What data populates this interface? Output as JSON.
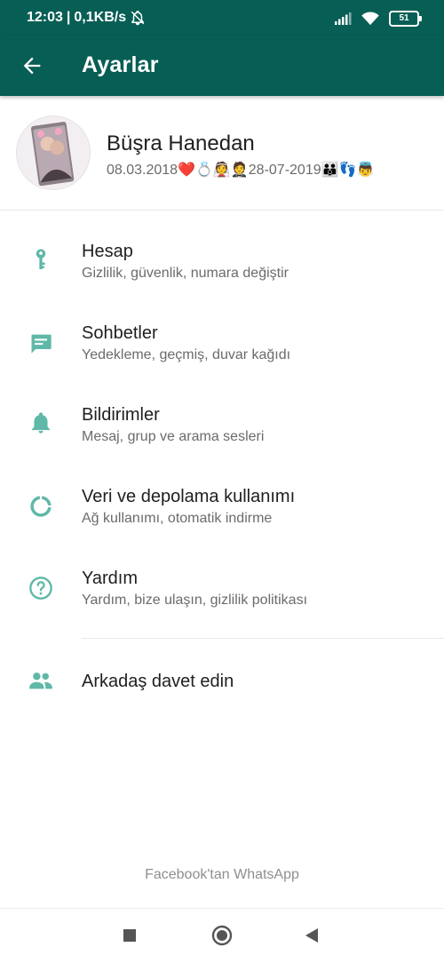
{
  "status_bar": {
    "time": "12:03",
    "network_speed": "0,1KB/s",
    "battery_level": "51",
    "icons": [
      "mute-icon",
      "signal-icon",
      "wifi-icon",
      "battery-icon"
    ]
  },
  "app_bar": {
    "title": "Ayarlar",
    "back_icon": "arrow-left-icon"
  },
  "profile": {
    "name": "Büşra Hanedan",
    "about": "08.03.2018❤️💍👰🤵28-07-2019👪👣👼"
  },
  "menu": [
    {
      "icon": "key-icon",
      "label": "Hesap",
      "sub": "Gizlilik, güvenlik, numara değiştir"
    },
    {
      "icon": "chat-icon",
      "label": "Sohbetler",
      "sub": "Yedekleme, geçmiş, duvar kağıdı"
    },
    {
      "icon": "bell-icon",
      "label": "Bildirimler",
      "sub": "Mesaj, grup ve arama sesleri"
    },
    {
      "icon": "data-usage-icon",
      "label": "Veri ve depolama kullanımı",
      "sub": "Ağ kullanımı, otomatik indirme"
    },
    {
      "icon": "help-icon",
      "label": "Yardım",
      "sub": "Yardım, bize ulaşın, gizlilik politikası"
    }
  ],
  "invite": {
    "icon": "people-icon",
    "label": "Arkadaş davet edin"
  },
  "footer": "Facebook'tan WhatsApp",
  "colors": {
    "primary_dark": "#075e54",
    "icon_teal": "#5fb8a8",
    "text_primary": "#1f1f1f",
    "text_secondary": "#6b6b6b"
  },
  "nav_bar": [
    "recent-apps-icon",
    "home-icon",
    "back-icon"
  ]
}
